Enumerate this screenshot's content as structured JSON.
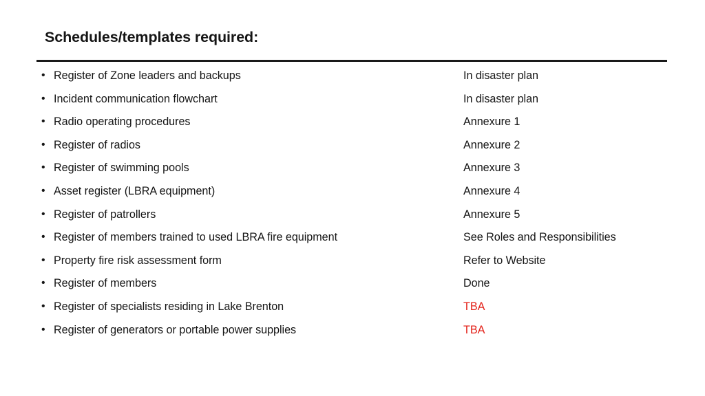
{
  "slide": {
    "title": "Schedules/templates required:",
    "bullet_marker": "•",
    "accent_rule_color": "#1a1a1a",
    "text_color": "#151515",
    "pending_color": "#e32119",
    "rows": [
      {
        "item": "Register of Zone leaders and backups",
        "reference": "In disaster plan",
        "pending": false
      },
      {
        "item": "Incident communication flowchart",
        "reference": "In disaster plan",
        "pending": false
      },
      {
        "item": "Radio operating procedures",
        "reference": "Annexure 1",
        "pending": false
      },
      {
        "item": "Register of radios",
        "reference": "Annexure 2",
        "pending": false
      },
      {
        "item": "Register of swimming pools",
        "reference": "Annexure 3",
        "pending": false
      },
      {
        "item": "Asset register (LBRA equipment)",
        "reference": "Annexure 4",
        "pending": false
      },
      {
        "item": "Register of patrollers",
        "reference": "Annexure 5",
        "pending": false
      },
      {
        "item": "Register of members trained to used LBRA fire equipment",
        "reference": "See Roles and Responsibilities",
        "pending": false
      },
      {
        "item": "Property fire risk assessment form",
        "reference": "Refer to Website",
        "pending": false
      },
      {
        "item": "Register of members",
        "reference": "Done",
        "pending": false
      },
      {
        "item": "Register of specialists residing in Lake Brenton",
        "reference": "TBA",
        "pending": true
      },
      {
        "item": "Register of generators or portable power supplies",
        "reference": "TBA",
        "pending": true
      }
    ]
  }
}
